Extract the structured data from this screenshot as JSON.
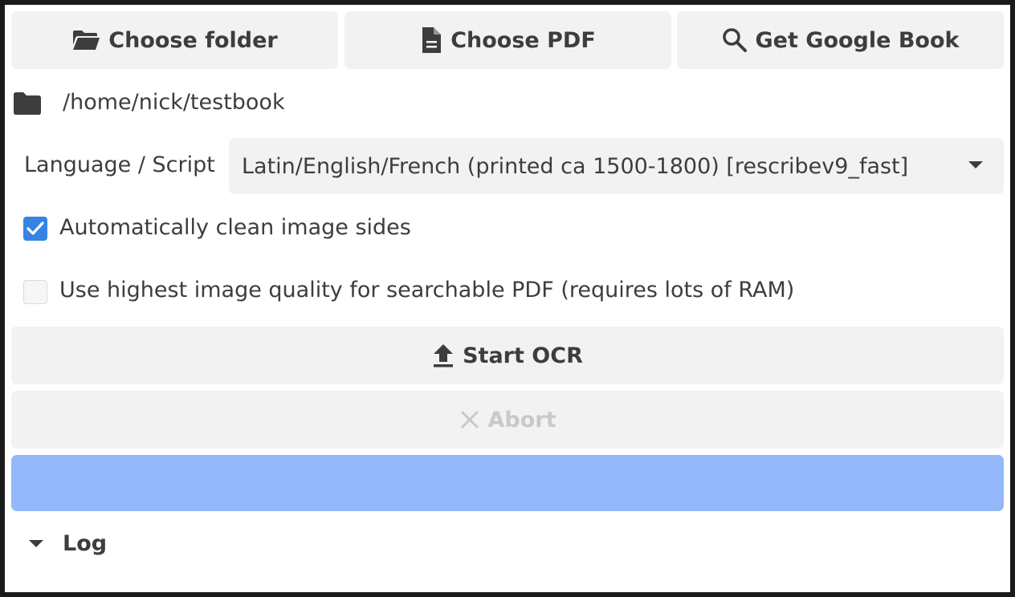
{
  "toolbar": {
    "choose_folder_label": "Choose folder",
    "choose_pdf_label": "Choose PDF",
    "get_google_book_label": "Get Google Book"
  },
  "path": {
    "value": "/home/nick/testbook",
    "icon": "folder-icon"
  },
  "language": {
    "label": "Language / Script",
    "selected": "Latin/English/French (printed ca 1500-1800) [rescribev9_fast]"
  },
  "options": {
    "auto_clean_label": "Automatically clean image sides",
    "auto_clean_checked": true,
    "high_quality_label": "Use highest image quality for searchable PDF (requires lots of RAM)",
    "high_quality_checked": false
  },
  "actions": {
    "start_label": "Start OCR",
    "abort_label": "Abort",
    "abort_enabled": false
  },
  "progress": {
    "fraction": 1.0
  },
  "log": {
    "label": "Log",
    "expanded": true
  },
  "colors": {
    "accent": "#3584e4",
    "progress_fill": "#94b7fa"
  }
}
